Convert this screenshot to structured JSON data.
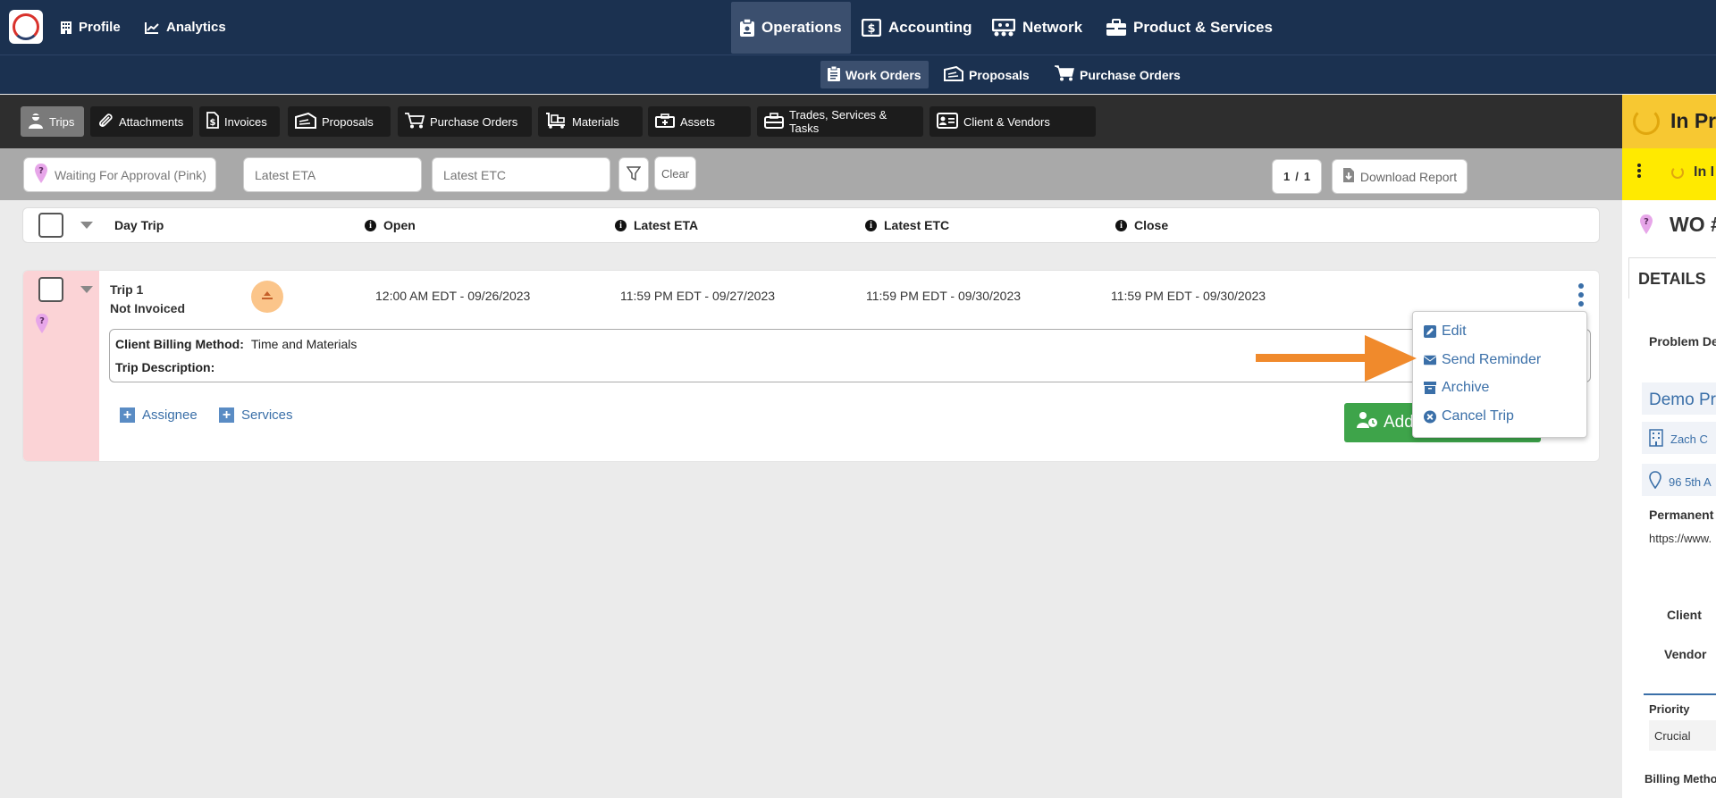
{
  "topnav": {
    "profile": "Profile",
    "analytics": "Analytics",
    "operations": "Operations",
    "accounting": "Accounting",
    "network": "Network",
    "product_services": "Product & Services"
  },
  "subnav": {
    "work_orders": "Work Orders",
    "proposals": "Proposals",
    "purchase_orders": "Purchase Orders"
  },
  "tabs": [
    "Trips",
    "Attachments",
    "Invoices",
    "Proposals",
    "Purchase Orders",
    "Materials",
    "Assets",
    "Trades, Services & Tasks",
    "Client & Vendors"
  ],
  "filters": {
    "status_placeholder": "Waiting For Approval (Pink)",
    "eta_placeholder": "Latest ETA",
    "etc_placeholder": "Latest ETC",
    "clear": "Clear",
    "page_current": "1",
    "page_sep": "/",
    "page_total": "1",
    "download_report": "Download Report"
  },
  "table": {
    "headers": {
      "day_trip": "Day Trip",
      "open": "Open",
      "latest_eta": "Latest ETA",
      "latest_etc": "Latest ETC",
      "close": "Close"
    }
  },
  "trip": {
    "name": "Trip 1",
    "invoice_status": "Not Invoiced",
    "open": "12:00 AM EDT - 09/26/2023",
    "latest_eta": "11:59 PM EDT - 09/27/2023",
    "latest_etc": "11:59 PM EDT - 09/30/2023",
    "close": "11:59 PM EDT - 09/30/2023",
    "billing_label": "Client Billing Method:",
    "billing_value": "Time and Materials",
    "description_label": "Trip Description:",
    "assignee": "Assignee",
    "services": "Services",
    "add_button": "Add"
  },
  "menu": {
    "edit": "Edit",
    "send_reminder": "Send Reminder",
    "archive": "Archive",
    "cancel_trip": "Cancel Trip"
  },
  "right_panel": {
    "status": "In Pr",
    "status_sub": "In I",
    "wo": "WO #",
    "details": "DETAILS",
    "problem": "Problem De",
    "demo": "Demo Pr",
    "company": "Zach C",
    "address": "96 5th A",
    "permanent": "Permanent",
    "url": "https://www.",
    "client": "Client",
    "vendor": "Vendor",
    "priority_label": "Priority",
    "priority_value": "Crucial",
    "billing": "Billing Metho"
  },
  "colors": {
    "nav": "#1b3150",
    "pink": "#fbd3d6",
    "link": "#3a6fa8",
    "status_yellow": "#f7c832",
    "arrow": "#f08a2c",
    "add_green": "#3ea44a"
  }
}
